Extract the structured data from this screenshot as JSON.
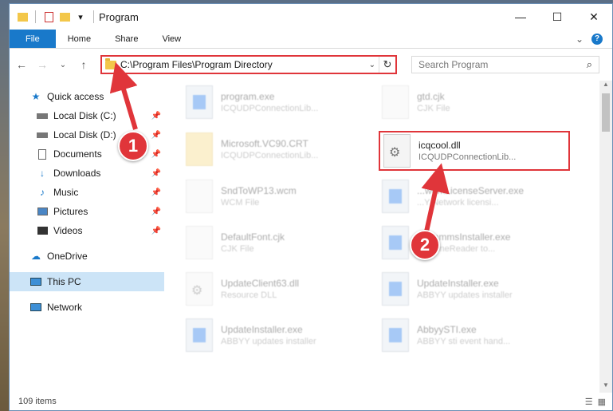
{
  "window": {
    "title": "Program",
    "qat_icons": [
      "folder-icon",
      "properties-icon",
      "new-folder-icon",
      "customize-icon"
    ]
  },
  "ribbon": {
    "tabs": [
      "File",
      "Home",
      "Share",
      "View"
    ],
    "expand_icon": "chevron-down-icon",
    "help_icon": "?"
  },
  "nav": {
    "back": "←",
    "forward": "→",
    "recent": "⌄",
    "up": "↑",
    "address": "C:\\Program Files\\Program Directory",
    "search_placeholder": "Search Program"
  },
  "sidebar": {
    "items": [
      {
        "label": "Quick access",
        "icon": "star-icon"
      },
      {
        "label": "Local Disk (C:)",
        "icon": "drive-icon",
        "pinned": true
      },
      {
        "label": "Local Disk (D:)",
        "icon": "drive-icon",
        "pinned": true
      },
      {
        "label": "Documents",
        "icon": "documents-icon",
        "pinned": true
      },
      {
        "label": "Downloads",
        "icon": "downloads-icon",
        "pinned": true
      },
      {
        "label": "Music",
        "icon": "music-icon",
        "pinned": true
      },
      {
        "label": "Pictures",
        "icon": "pictures-icon",
        "pinned": true
      },
      {
        "label": "Videos",
        "icon": "videos-icon",
        "pinned": true
      },
      {
        "label": "OneDrive",
        "icon": "cloud-icon"
      },
      {
        "label": "This PC",
        "icon": "computer-icon",
        "selected": true
      },
      {
        "label": "Network",
        "icon": "network-icon"
      }
    ]
  },
  "files": [
    {
      "name": "program.exe",
      "desc": "ICQUDPConnectionLib..."
    },
    {
      "name": "gtd.cjk",
      "desc": "CJK File"
    },
    {
      "name": "Microsoft.VC90.CRT",
      "desc": "ICQUDPConnectionLib..."
    },
    {
      "name": "icqcool.dll",
      "desc": "ICQUDPConnectionLib..."
    },
    {
      "name": "SndToWP13.wcm",
      "desc": "WCM File"
    },
    {
      "name": "...workLicenseServer.exe",
      "desc": "...Y Network licensi..."
    },
    {
      "name": "DefaultFont.cjk",
      "desc": "CJK File"
    },
    {
      "name": "...grammsInstaller.exe",
      "desc": "...Y FineReader to..."
    },
    {
      "name": "UpdateClient63.dll",
      "desc": "Resource DLL"
    },
    {
      "name": "UpdateInstaller.exe",
      "desc": "ABBYY updates installer"
    },
    {
      "name": "UpdateInstaller.exe",
      "desc": "ABBYY updates installer"
    },
    {
      "name": "AbbyySTI.exe",
      "desc": "ABBYY sti event hand..."
    }
  ],
  "status": {
    "count": "109 items"
  },
  "callouts": {
    "one": "1",
    "two": "2"
  },
  "colors": {
    "accent": "#1979ca",
    "highlight": "#e0353a",
    "selected": "#cce4f7"
  }
}
